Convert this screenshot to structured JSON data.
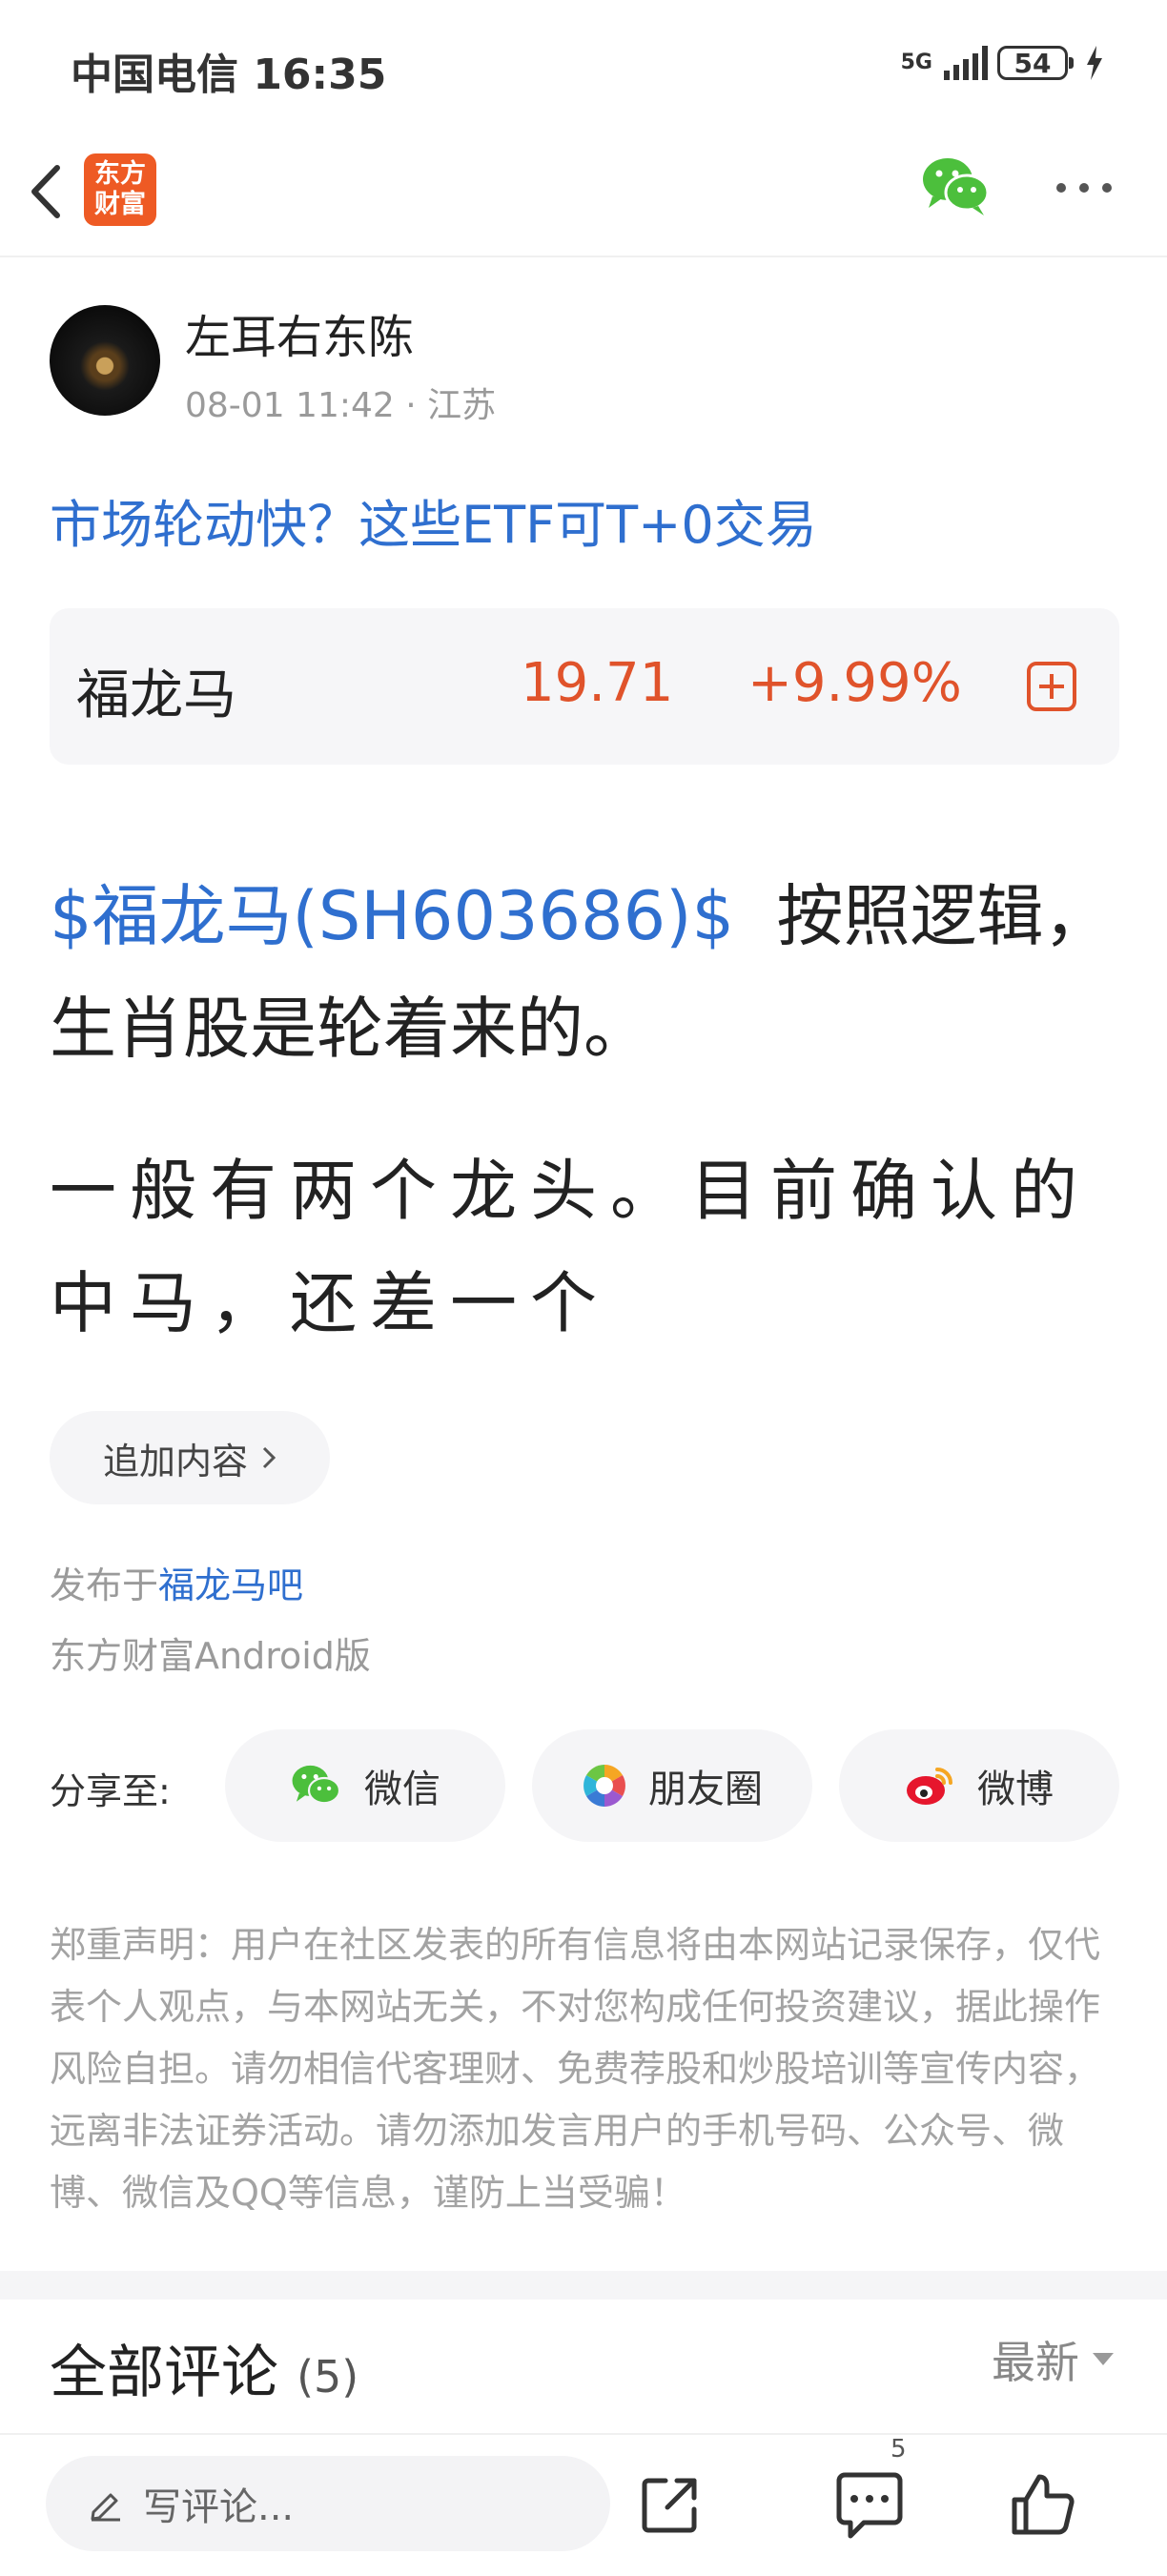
{
  "status_bar": {
    "carrier_time": "中国电信 16:35",
    "network": "5G",
    "battery": "54"
  },
  "nav": {
    "logo_line1": "东方",
    "logo_line2": "财富"
  },
  "post": {
    "author": "左耳右东陈",
    "meta": "08-01 11:42 · 江苏",
    "article_link": "市场轮动快？这些ETF可T+0交易",
    "stock": {
      "name": "福龙马",
      "price": "19.71",
      "change": "+9.99%"
    },
    "body_stock_tag": "$福龙马(SH603686)$",
    "body_para_1_rest": "  按照逻辑，生肖股是轮着来的。",
    "body_para_2": "一般有两个龙头。目前确认的中马，还差一个",
    "append_label": "追加内容",
    "published_prefix": "发布于",
    "forum": "福龙马吧",
    "client": "东方财富Android版"
  },
  "share": {
    "label": "分享至:",
    "wechat": "微信",
    "moments": "朋友圈",
    "weibo": "微博"
  },
  "disclaimer": "郑重声明：用户在社区发表的所有信息将由本网站记录保存，仅代表个人观点，与本网站无关，不对您构成任何投资建议，据此操作风险自担。请勿相信代客理财、免费荐股和炒股培训等宣传内容，远离非法证券活动。请勿添加发言用户的手机号码、公众号、微博、微信及QQ等信息，谨防上当受骗！",
  "comments": {
    "title": "全部评论",
    "count": "(5)",
    "sort": "最新"
  },
  "bottom_bar": {
    "placeholder": "写评论...",
    "comment_count": "5"
  },
  "colors": {
    "link_blue": "#2f6fcf",
    "stock_red": "#e0532b",
    "brand_orange": "#ee5a24"
  }
}
